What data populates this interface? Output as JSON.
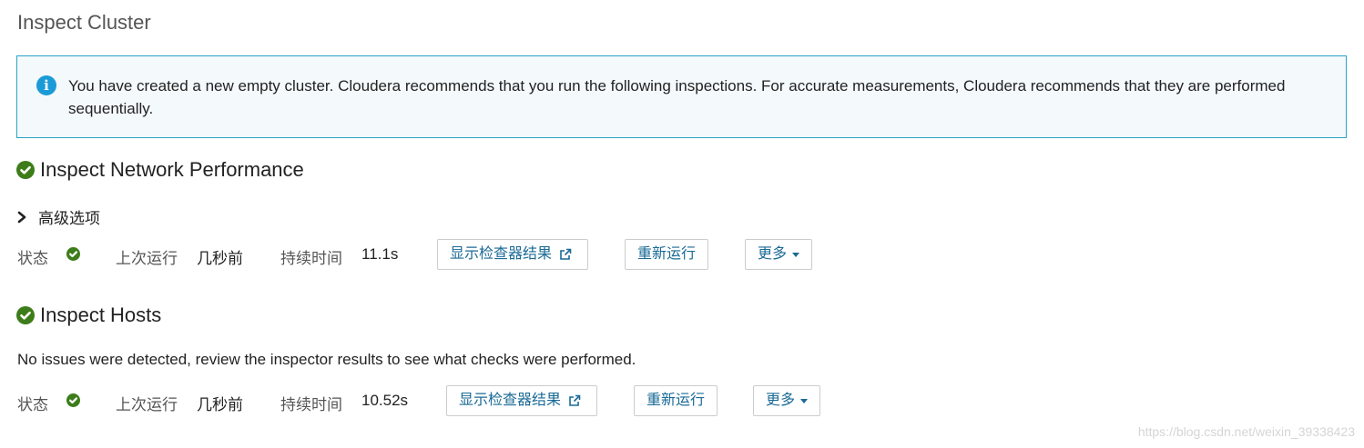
{
  "page": {
    "title": "Inspect Cluster"
  },
  "info": {
    "icon": "info-icon",
    "message": "You have created a new empty cluster. Cloudera recommends that you run the following inspections. For accurate measurements, Cloudera recommends that they are performed sequentially."
  },
  "network": {
    "title": "Inspect Network Performance",
    "advanced_label": "高级选项",
    "status_label": "状态",
    "last_run_label": "上次运行",
    "last_run_value": "几秒前",
    "duration_label": "持续时间",
    "duration_value": "11.1s",
    "show_results_label": "显示检查器结果",
    "rerun_label": "重新运行",
    "more_label": "更多"
  },
  "hosts": {
    "title": "Inspect Hosts",
    "message": "No issues were detected, review the inspector results to see what checks were performed.",
    "status_label": "状态",
    "last_run_label": "上次运行",
    "last_run_value": "几秒前",
    "duration_label": "持续时间",
    "duration_value": "10.52s",
    "show_results_label": "显示检查器结果",
    "rerun_label": "重新运行",
    "more_label": "更多"
  },
  "watermark": "https://blog.csdn.net/weixin_39338423",
  "colors": {
    "success": "#3c7d1a",
    "info": "#1a9bd7",
    "info_border": "#2aa3c6",
    "link": "#1a6a96"
  }
}
